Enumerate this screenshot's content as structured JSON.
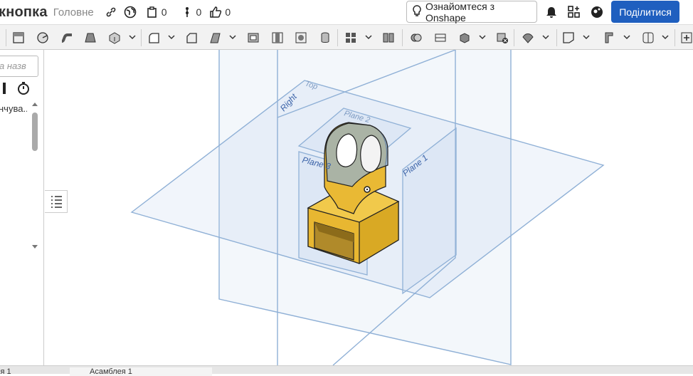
{
  "header": {
    "title": "кнопка",
    "workspace": "Головне",
    "counts": {
      "versions": "0",
      "branches": "0",
      "likes": "0"
    },
    "learn_label": "Ознайомтеся з Onshape",
    "share_label": "Поділитися"
  },
  "toolbar": {
    "tools": [
      "sketch-tool",
      "extrude-tool",
      "revolve-tool",
      "sweep-tool",
      "loft-tool",
      "thicken-tool",
      "fillet-tool",
      "chamfer-tool",
      "draft-tool",
      "shell-tool",
      "hole-tool",
      "rib-tool",
      "cylinder-tool",
      "pattern-tool",
      "mirror-tool",
      "boolean-tool",
      "split-tool",
      "transform-tool",
      "delete-part-tool",
      "plane-tool",
      "frame-tool",
      "sheet-metal-tool",
      "surface-tool",
      "add-custom-feature-tool"
    ]
  },
  "feature_panel": {
    "search_placeholder": "а назв",
    "feature_item": "нчува..."
  },
  "viewport": {
    "planes": [
      "Top",
      "Right",
      "Plane 2",
      "Plane 3",
      "Plane 1"
    ]
  },
  "tabs": [
    "ія 1",
    "Асамблея 1"
  ],
  "colors": {
    "accent": "#1f5fbf",
    "part": "#e8b731",
    "plane": "#8fb0d6"
  }
}
